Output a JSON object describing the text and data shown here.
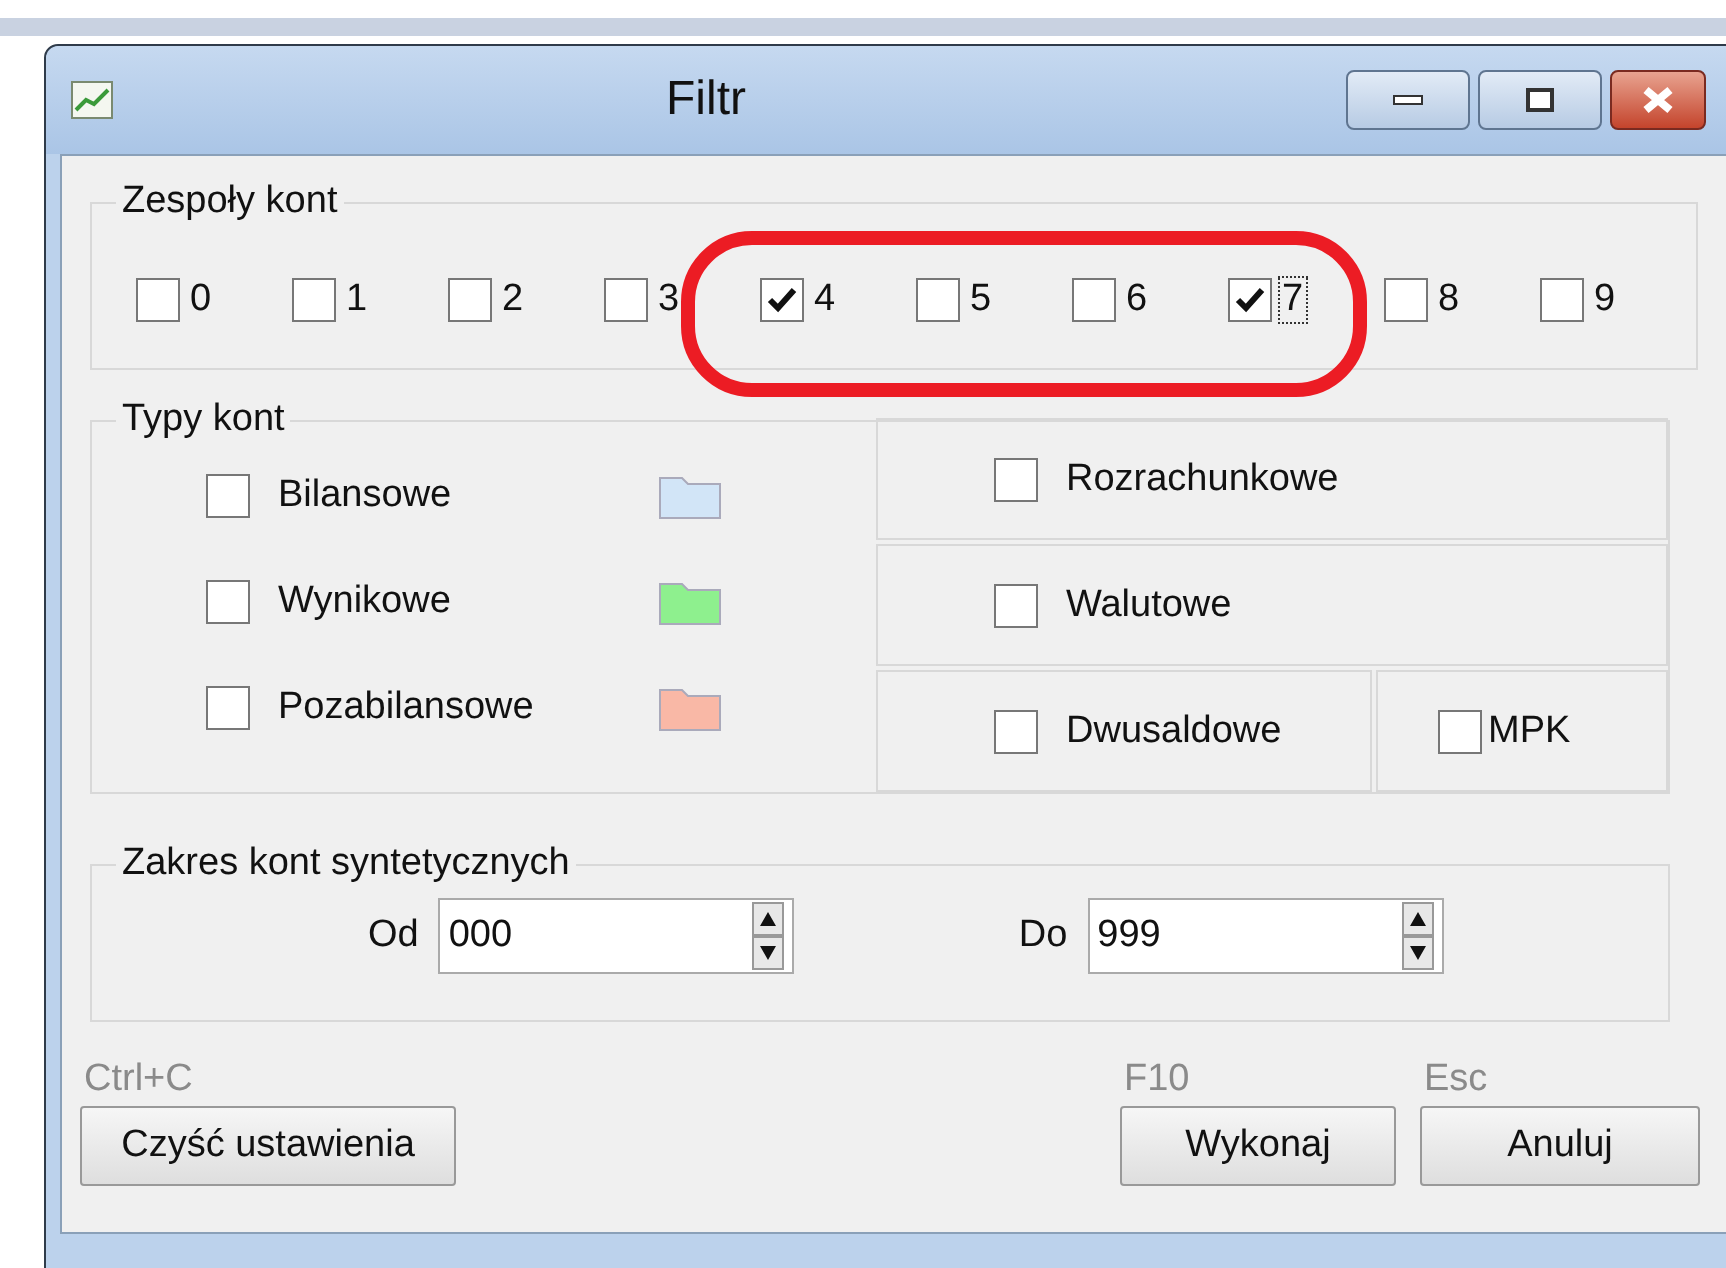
{
  "window": {
    "title": "Filtr"
  },
  "account_groups": {
    "title": "Zespoły kont",
    "items": [
      {
        "label": "0",
        "checked": false,
        "focused": false
      },
      {
        "label": "1",
        "checked": false,
        "focused": false
      },
      {
        "label": "2",
        "checked": false,
        "focused": false
      },
      {
        "label": "3",
        "checked": false,
        "focused": false
      },
      {
        "label": "4",
        "checked": true,
        "focused": false
      },
      {
        "label": "5",
        "checked": false,
        "focused": false
      },
      {
        "label": "6",
        "checked": false,
        "focused": false
      },
      {
        "label": "7",
        "checked": true,
        "focused": true
      },
      {
        "label": "8",
        "checked": false,
        "focused": false
      },
      {
        "label": "9",
        "checked": false,
        "focused": false
      }
    ]
  },
  "account_types": {
    "title": "Typy kont",
    "items": [
      {
        "label": "Bilansowe",
        "checked": false,
        "color": "#d2e5f7"
      },
      {
        "label": "Wynikowe",
        "checked": false,
        "color": "#8ef08e"
      },
      {
        "label": "Pozabilansowe",
        "checked": false,
        "color": "#f9b8a6"
      }
    ],
    "options": [
      {
        "label": "Rozrachunkowe",
        "checked": false,
        "kind": "full"
      },
      {
        "label": "Walutowe",
        "checked": false,
        "kind": "full"
      },
      {
        "label": "Dwusaldowe",
        "checked": false,
        "kind": "half"
      },
      {
        "label": "MPK",
        "checked": false,
        "kind": "half"
      }
    ]
  },
  "range": {
    "title": "Zakres kont syntetycznych",
    "from": {
      "label": "Od",
      "value": "000"
    },
    "to": {
      "label": "Do",
      "value": "999"
    }
  },
  "buttons": [
    {
      "shortcut": "Ctrl+C",
      "label": "Czyść ustawienia"
    },
    {
      "shortcut": "F10",
      "label": "Wykonaj"
    },
    {
      "shortcut": "Esc",
      "label": "Anuluj"
    }
  ]
}
